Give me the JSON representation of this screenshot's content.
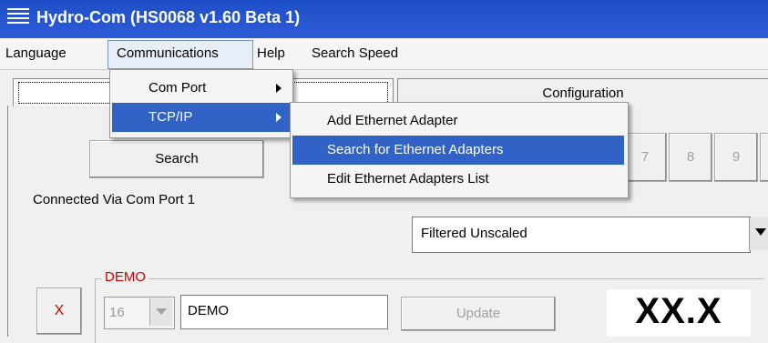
{
  "window": {
    "title": "Hydro-Com (HS0068 v1.60 Beta 1)"
  },
  "menubar": {
    "items": [
      "Language",
      "Communications",
      "Help",
      "Search Speed"
    ]
  },
  "tabs": [
    {
      "label": ""
    },
    {
      "label": "Configuration"
    }
  ],
  "toolbar": {
    "search_label": "Search",
    "number_buttons": [
      "7",
      "8",
      "9"
    ]
  },
  "status": {
    "connected": "Connected Via Com Port 1"
  },
  "filter": {
    "selected": "Filtered Unscaled"
  },
  "demo": {
    "legend": "DEMO",
    "x_label": "X",
    "number": "16",
    "name": "DEMO",
    "update_label": "Update",
    "value": "XX.X"
  },
  "communications_menu": {
    "items": [
      "Com Port",
      "TCP/IP"
    ],
    "selected": "TCP/IP"
  },
  "tcpip_submenu": {
    "items": [
      "Add Ethernet Adapter",
      "Search for Ethernet Adapters",
      "Edit Ethernet Adapters List"
    ],
    "highlighted": "Search for Ethernet Adapters"
  },
  "colors": {
    "title_bar": "#2b5bd6",
    "menu_highlight": "#3163c6",
    "demo_red": "#d00000"
  }
}
